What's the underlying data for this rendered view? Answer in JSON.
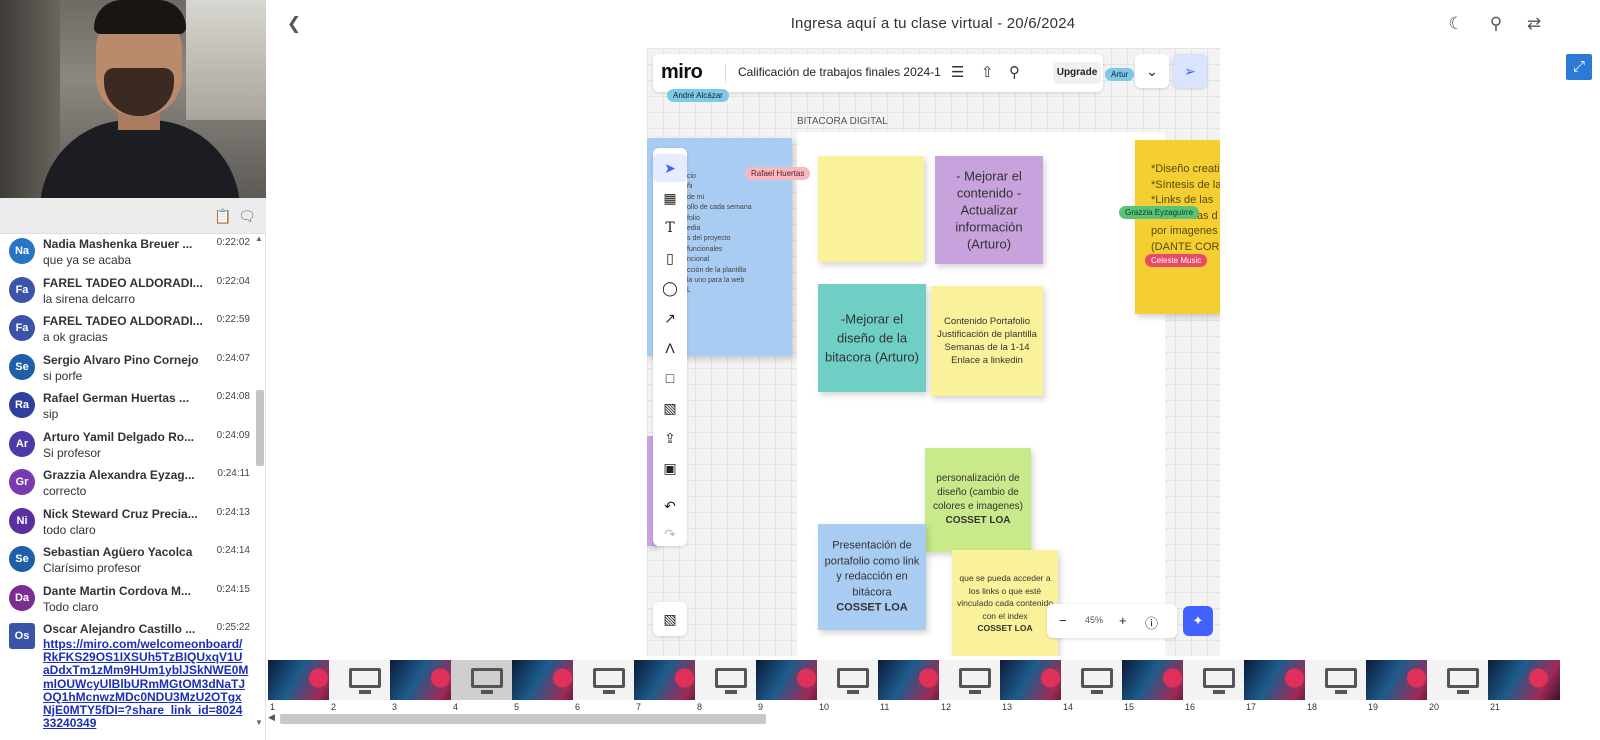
{
  "header": {
    "title": "Ingresa aquí a tu clase virtual - 20/6/2024"
  },
  "chat": {
    "messages": [
      {
        "initials": "Na",
        "name": "Nadia Mashenka Breuer ...",
        "time": "0:22:02",
        "text": "que ya se acaba",
        "color": "#2a74c8"
      },
      {
        "initials": "Fa",
        "name": "FAREL TADEO ALDORADI...",
        "time": "0:22:04",
        "text": "la sirena delcarro",
        "color": "#3a55a8"
      },
      {
        "initials": "Fa",
        "name": "FAREL TADEO ALDORADI...",
        "time": "0:22:59",
        "text": "a ok gracias",
        "color": "#3a55a8"
      },
      {
        "initials": "Se",
        "name": "Sergio Alvaro Pino Cornejo",
        "time": "0:24:07",
        "text": "si porfe",
        "color": "#1f5fa8"
      },
      {
        "initials": "Ra",
        "name": "Rafael German Huertas ...",
        "time": "0:24:08",
        "text": "sip",
        "color": "#2f3f9e"
      },
      {
        "initials": "Ar",
        "name": "Arturo Yamil Delgado Ro...",
        "time": "0:24:09",
        "text": "Si profesor",
        "color": "#4b3aa8"
      },
      {
        "initials": "Gr",
        "name": "Grazzia Alexandra Eyzag...",
        "time": "0:24:11",
        "text": "correcto",
        "color": "#7a3ab0"
      },
      {
        "initials": "Ni",
        "name": "Nick Steward Cruz Precia...",
        "time": "0:24:13",
        "text": "todo claro",
        "color": "#5a2fa0"
      },
      {
        "initials": "Se",
        "name": "Sebastian Agüero Yacolca",
        "time": "0:24:14",
        "text": "Clarísimo profesor",
        "color": "#1f5fa8"
      },
      {
        "initials": "Da",
        "name": "Dante Martin Cordova M...",
        "time": "0:24:15",
        "text": "Todo claro",
        "color": "#7a2f90"
      }
    ],
    "last": {
      "initials": "Os",
      "name": "Oscar Alejandro Castillo ...",
      "time": "0:25:22",
      "link": "https://miro.com/welcomeonboard/RkFKS29OS1IXSUh5TzBIQUxqV1UaDdxTm1zMm9HUm1yblJSkNWE0MmlOUWcyUlBlbURmMGtOM3dNaTJOQ1hMcnwzMDc0NDU3MzU2OTgxNjE0MTY5fDI=?share_link_id=802433240349",
      "color": "#3a55a8"
    }
  },
  "miro": {
    "logo": "miro",
    "board_name": "Calificación de trabajos finales 2024-1",
    "upgrade": "Upgrade",
    "frame_label": "BITACORA DIGITAL",
    "zoom": "45%",
    "cursors": {
      "andre": "André Alcázar",
      "rafael": "Rafael Huertas",
      "grazzia": "Grazzia Eyzaguirre",
      "celeste": "Celeste Music",
      "arturo": "Artur"
    },
    "stickies": {
      "purple": "- Mejorar el contenido -Actualizar información (Arturo)",
      "teal": "-Mejorar el diseño de la bitacora (Arturo)",
      "contenido": "Contenido Portafolio Justificación de plantilla Semanas de la 1-14 Enlace a linkedin",
      "green_text": "personalización de diseño (cambio de colores e imagenes)",
      "green_author": "COSSET LOA",
      "blue_text": "Presentación de portafolio como link y redacción en bitácora",
      "blue_author": "COSSET LOA",
      "yellow2_text": "que se pueda acceder a los links o que esté vinculado cada contenido con el index",
      "yellow2_author": "COSSET LOA",
      "gold_lines": [
        "*Diseño creati",
        "*Síntesis de la",
        "*Links de las",
        "*Evidencias d",
        "por imagenes",
        "(DANTE CORD"
      ],
      "left_blue_lines": [
        "cio",
        "ñi",
        "de mi",
        "ollo de cada semana",
        "folio",
        "edia",
        "s del proyecto",
        "funcionales",
        "ncional",
        "cción de la plantilla",
        "la uno para la web",
        "L"
      ]
    }
  },
  "thumbnails": {
    "numbers": [
      "1",
      "2",
      "3",
      "4",
      "5",
      "6",
      "7",
      "8",
      "9",
      "10",
      "11",
      "12",
      "13",
      "14",
      "15",
      "16",
      "17",
      "18",
      "19",
      "20",
      "21"
    ]
  }
}
